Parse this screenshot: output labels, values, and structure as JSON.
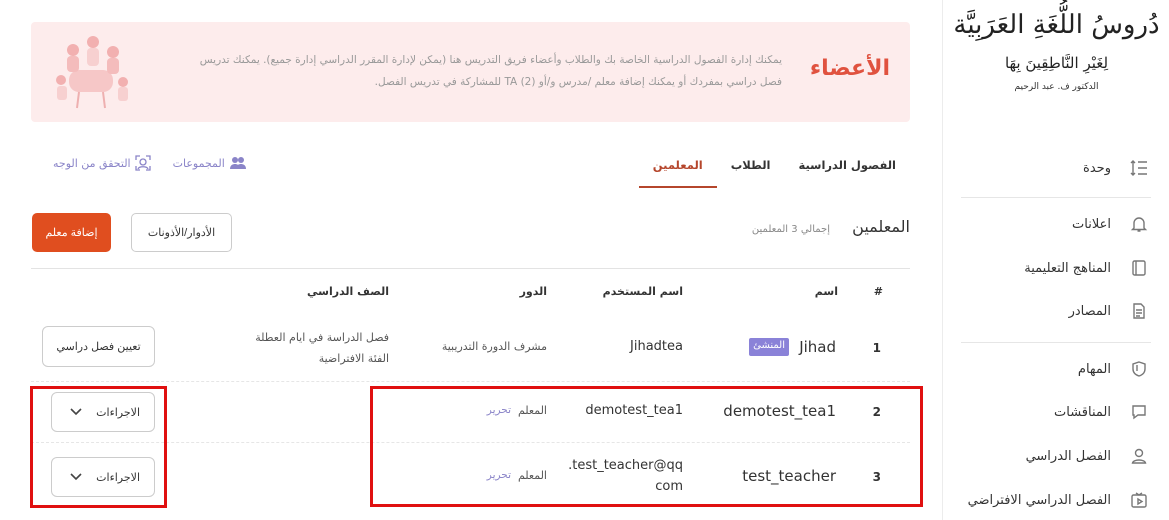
{
  "sidebar": {
    "logo": {
      "line1": "دُروسُ اللُّغَةِ العَرَبِيَّة",
      "line2": "لِغَيْرِ النَّاطِقِينَ بِهَا",
      "line3": "الدكتور ف. عبد الرحيم"
    },
    "items": [
      {
        "label": "وحدة",
        "icon": "list-indent-icon"
      },
      {
        "label": "اعلانات",
        "icon": "bell-icon"
      },
      {
        "label": "المناهج التعليمية",
        "icon": "book-icon"
      },
      {
        "label": "المصادر",
        "icon": "document-icon"
      },
      {
        "label": "المهام",
        "icon": "shield-icon"
      },
      {
        "label": "المناقشات",
        "icon": "chat-icon"
      },
      {
        "label": "الفصل الدراسي",
        "icon": "user-icon"
      },
      {
        "label": "الفصل الدراسي الافتراضي",
        "icon": "video-icon"
      }
    ]
  },
  "banner": {
    "title": "الأعضاء",
    "line1": "يمكنك إدارة الفصول الدراسية الخاصة بك والطلاب وأعضاء فريق التدريس هنا (يمكن لإدارة المقرر الدراسي إدارة جميع). يمكنك تدريس",
    "line2": "فصل دراسي بمفردك أو يمكنك إضافة معلم /مدرس و/أو TA (2) للمشاركة في تدريس الفصل."
  },
  "tabs": [
    {
      "label": "الفصول الدراسية",
      "active": false
    },
    {
      "label": "الطلاب",
      "active": false
    },
    {
      "label": "المعلمين",
      "active": true
    }
  ],
  "tools": {
    "groups": "المجموعات",
    "face_verify": "التحقق من الوجه"
  },
  "section": {
    "title": "المعلمين",
    "count": "إجمالي 3 المعلمين",
    "roles_button": "الأدوار/الأذونات",
    "add_button": "إضافة معلم"
  },
  "table": {
    "headers": {
      "num": "#",
      "name": "اسم",
      "username": "اسم المستخدم",
      "role": "الدور",
      "class": "الصف الدراسي"
    },
    "rows": [
      {
        "num": "1",
        "name": "Jihad",
        "badge": "المنشئ",
        "username": "Jihadtea",
        "role": "مشرف الدورة التدريبية",
        "class_line1": "فصل الدراسة في ايام العطلة",
        "class_line2": "الفئة الافتراضية",
        "action": "تعيين فصل دراسي"
      },
      {
        "num": "2",
        "name": "demotest_tea1",
        "username": "demotest_tea1",
        "role": "المعلم",
        "edit": "تحرير",
        "action": "الاجراءات"
      },
      {
        "num": "3",
        "name": "test_teacher",
        "username_line1": "test_teacher@qq.",
        "username_line2": "com",
        "role": "المعلم",
        "edit": "تحرير",
        "action": "الاجراءات"
      }
    ]
  },
  "colors": {
    "accent": "#e04e1f",
    "tab_active": "#b5462c",
    "link": "#8a84c8",
    "banner_bg": "#fdecec",
    "highlight": "#e01010"
  }
}
